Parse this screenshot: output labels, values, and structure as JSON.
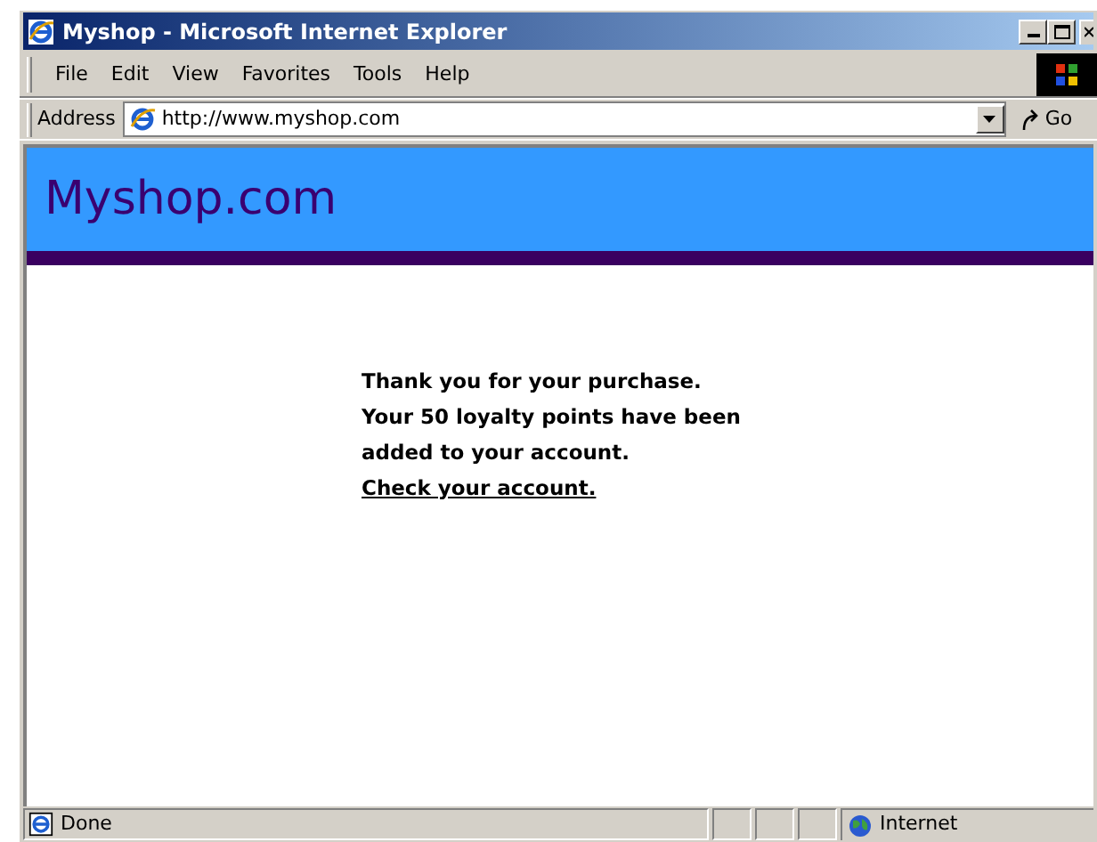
{
  "window": {
    "title": "Myshop - Microsoft Internet Explorer"
  },
  "menu": [
    "File",
    "Edit",
    "View",
    "Favorites",
    "Tools",
    "Help"
  ],
  "address_bar": {
    "label": "Address",
    "value": "http://www.myshop.com",
    "go": "Go"
  },
  "page": {
    "site_title": "Myshop.com",
    "message_lines": [
      "Thank you for your purchase.",
      "Your 50 loyalty points have been",
      "added to your account."
    ],
    "link": "Check your account."
  },
  "status_bar": {
    "status": "Done",
    "zone": "Internet"
  }
}
